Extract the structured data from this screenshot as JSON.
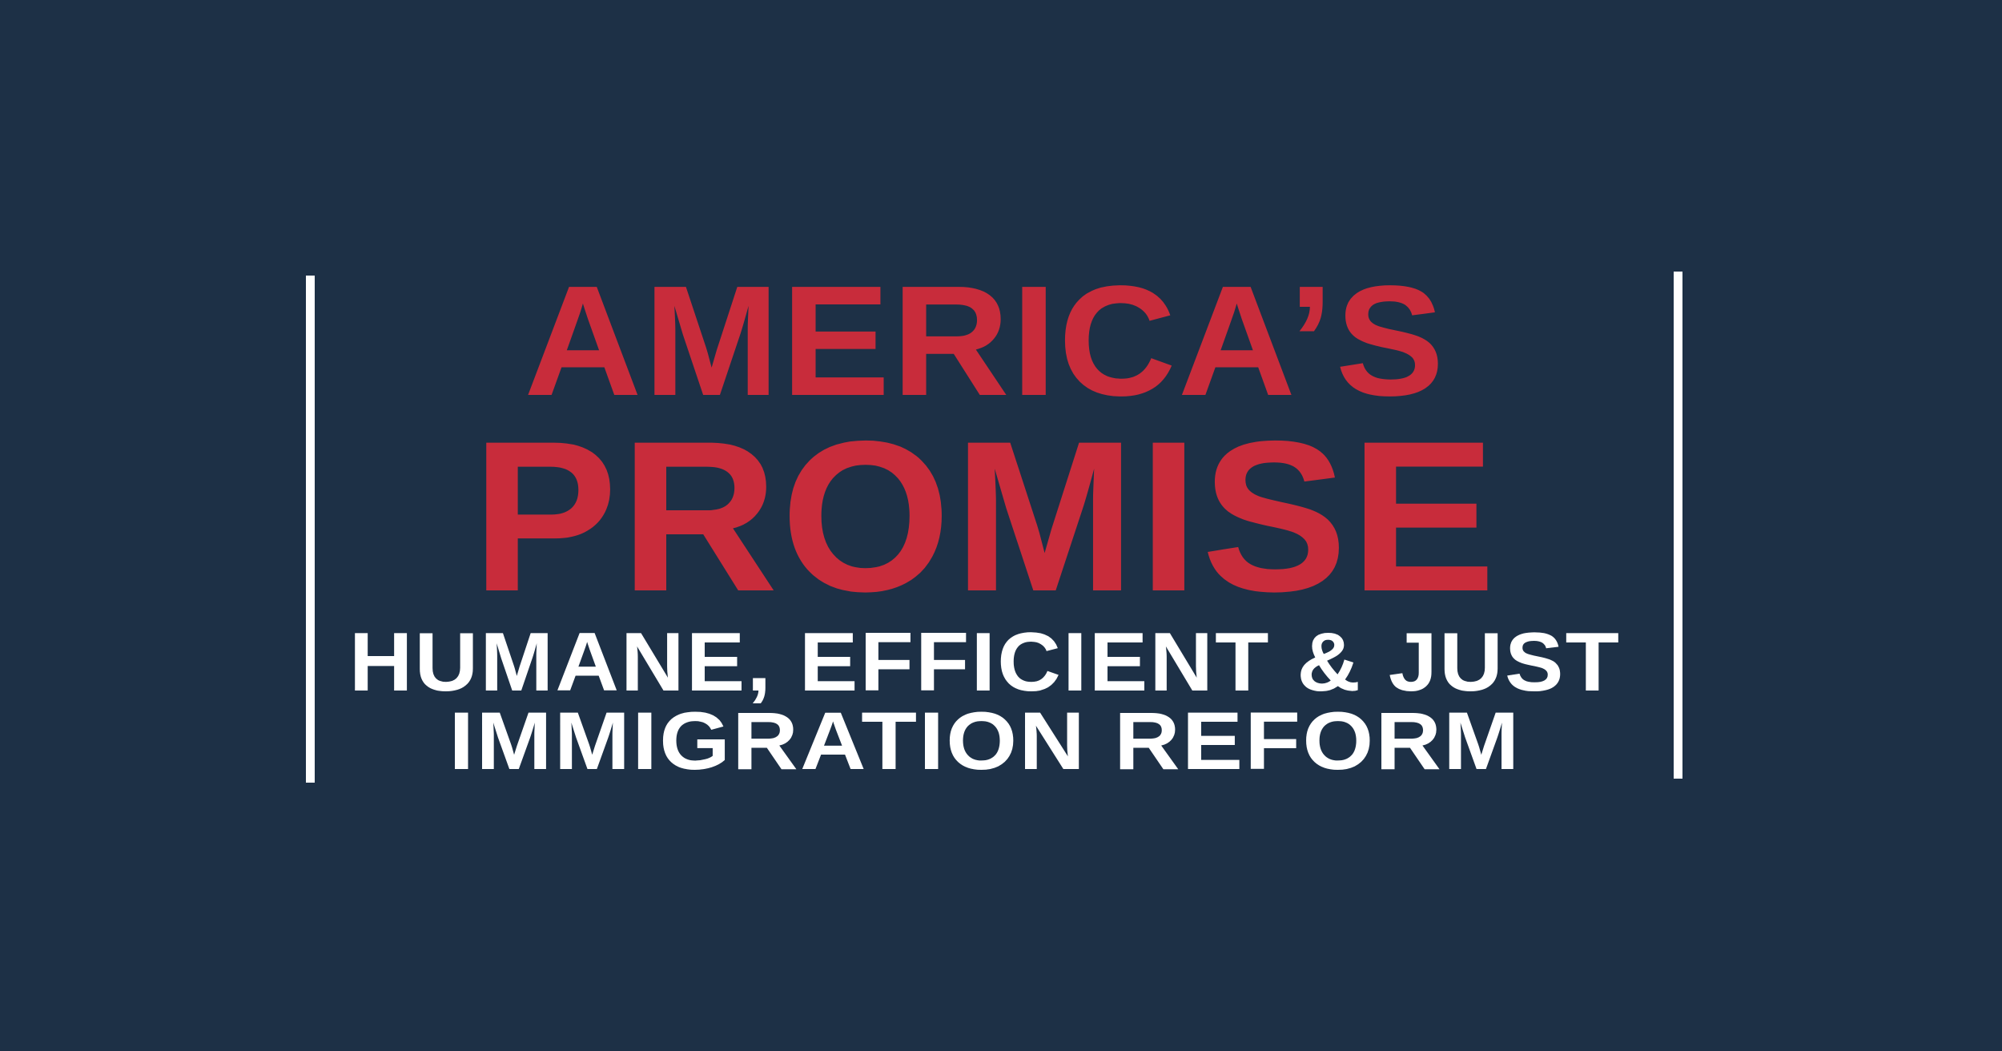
{
  "banner": {
    "title_line1": "AMERICA’S",
    "title_line2": "PROMISE",
    "subtitle_line1": "HUMANE, EFFICIENT & JUST",
    "subtitle_line2": "IMMIGRATION REFORM"
  },
  "colors": {
    "background": "#1d3046",
    "title": "#c82c3b",
    "subtitle": "#ffffff",
    "divider": "#ffffff"
  }
}
